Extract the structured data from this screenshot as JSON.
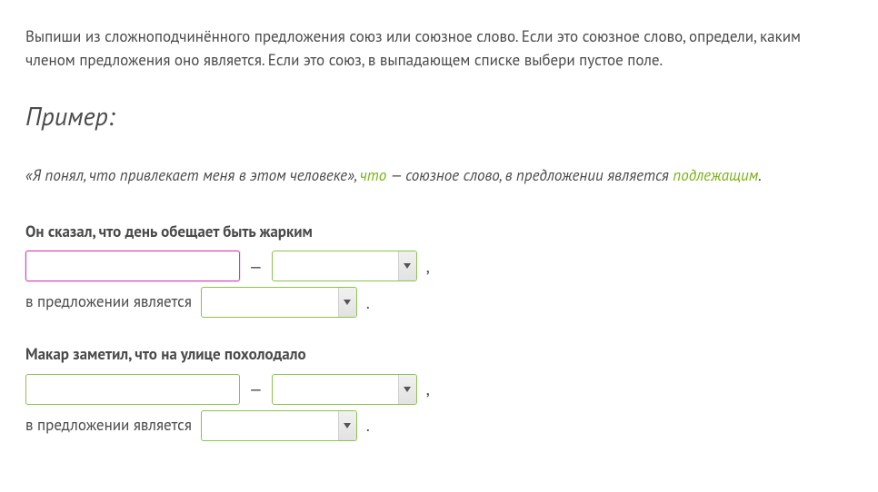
{
  "instruction": "Выпиши из сложноподчинённого предложения союз или союзное слово. Если это союзное слово, определи, каким членом предложения оно является. Если это союз, в выпадающем списке выбери пустое поле.",
  "example": {
    "heading": "Пример:",
    "prefix": "«Я понял, что привлекает меня в этом человеке», ",
    "answer_word": "что",
    "mid": " — союзное слово, в предложении является ",
    "role": "подлежащим",
    "suffix": "."
  },
  "labels": {
    "dash": "—",
    "comma": ",",
    "period": ".",
    "role_prefix": "в предложении является"
  },
  "tasks": [
    {
      "sentence": "Он сказал, что день обещает быть жарким",
      "input_value": "",
      "input_focused": true,
      "select1_value": "",
      "select2_value": ""
    },
    {
      "sentence": "Макар заметил, что на улице похолодало",
      "input_value": "",
      "input_focused": false,
      "select1_value": "",
      "select2_value": ""
    }
  ]
}
